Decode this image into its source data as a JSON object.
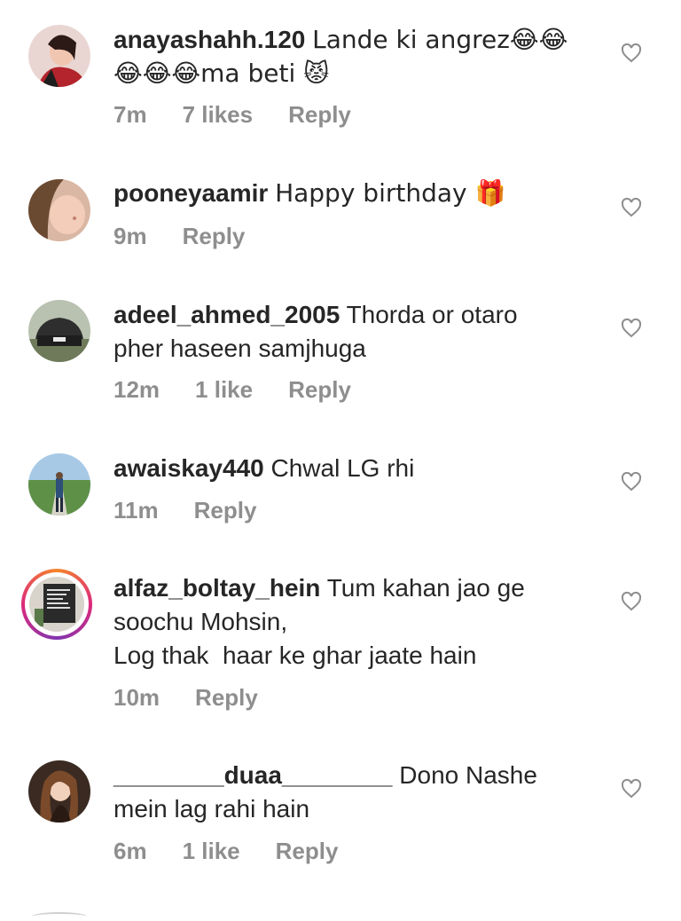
{
  "comments": [
    {
      "username": "anayashahh.120",
      "text": "Lande ki angrez😂😂\n😂😂😂ma beti 😾",
      "time": "7m",
      "likes": "7 likes",
      "reply": "Reply"
    },
    {
      "username": "pooneyaamir",
      "text": "Happy birthday 🎁",
      "time": "9m",
      "likes": "",
      "reply": "Reply"
    },
    {
      "username": "adeel_ahmed_2005",
      "text": "Thorda or otaro\npher haseen samjhuga",
      "time": "12m",
      "likes": "1 like",
      "reply": "Reply"
    },
    {
      "username": "awaiskay440",
      "text": "Chwal LG rhi",
      "time": "11m",
      "likes": "",
      "reply": "Reply"
    },
    {
      "username": "alfaz_boltay_hein",
      "text": "Tum kahan jao ge\nsoochu Mohsin,\nLog thak  haar ke ghar jaate hain",
      "time": "10m",
      "likes": "",
      "reply": "Reply"
    },
    {
      "username": "________duaa________",
      "text": "Dono Nashe\nmein lag rahi hain",
      "time": "6m",
      "likes": "1 like",
      "reply": "Reply"
    }
  ],
  "icons": {
    "like": "heart-outline-icon"
  },
  "colors": {
    "text": "#262626",
    "meta": "#8e8e8e",
    "heart": "#8e8e8e"
  }
}
